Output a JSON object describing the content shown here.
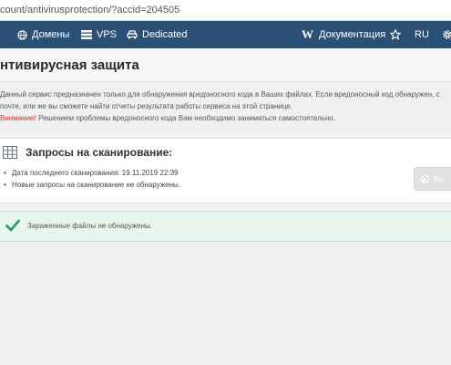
{
  "browser": {
    "url": "count/antivirusprotection/?accid=204505"
  },
  "nav": {
    "items": [
      {
        "label": "Домены",
        "icon": "globe-icon"
      },
      {
        "label": "VPS",
        "icon": "server-icon"
      },
      {
        "label": "Dedicated",
        "icon": "car-icon"
      }
    ],
    "docs_label": "Документация",
    "docs_icon": "wikipedia-w-icon",
    "lang": "RU",
    "colors": {
      "navbar": "#2b5076"
    }
  },
  "page": {
    "title": "нтивирусная защита",
    "description_line1": "Данный сервис предназначен только для обнаружения вредоносного кода в Ваших файлах. Если вредоносный код обнаружен, с",
    "description_line2": "почте, или же вы сможете найти отчеты результата работы сервиса на этой странице.",
    "warning_word": "Внимание!",
    "warning_rest": " Решением проблемы вредоносного кода Вам необходимо заниматься самостоятельно."
  },
  "scan": {
    "title": "Запросы на сканирование:",
    "last_scan": "Дата последнего сканирования: 19.11.2019 22:39",
    "no_new": "Новые запросы на сканирование не обнаружены.",
    "button_label": "Вы"
  },
  "status": {
    "message": "Зараженные файлы не обнаружены.",
    "color": "#2e9e63"
  }
}
